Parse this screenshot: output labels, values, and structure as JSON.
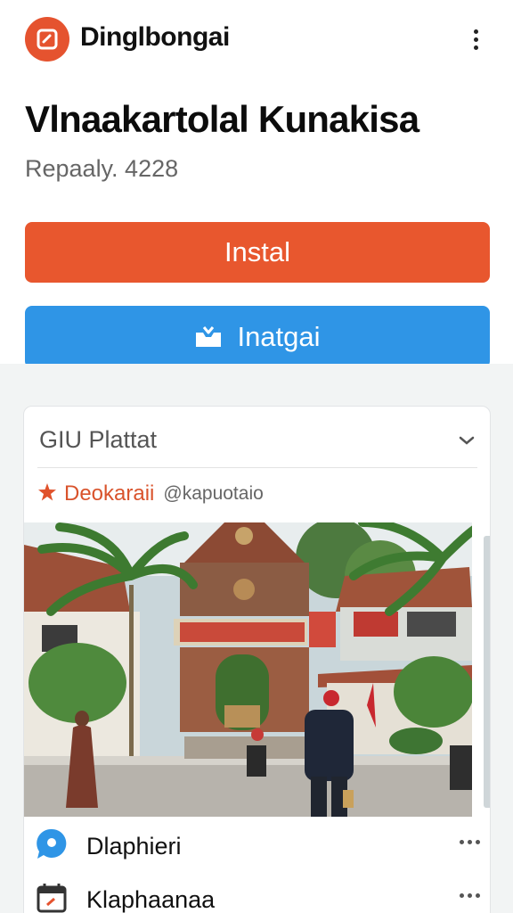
{
  "app": {
    "name": "Dinglbongai"
  },
  "title": "Vlnaakartolal Kunakisa",
  "subtitle": "Repaaly. 4228",
  "buttons": {
    "install_label": "Instal",
    "secondary_label": "Inatgai"
  },
  "card": {
    "heading": "GIU Plattat",
    "author": "Deokaraii",
    "handle": "@kapuotaio",
    "items": [
      {
        "label": "Dlaphieri",
        "icon": "chat-bubble-icon"
      },
      {
        "label": "Klaphaanaa",
        "icon": "calendar-icon"
      }
    ]
  },
  "colors": {
    "accent_orange": "#e8572e",
    "accent_blue": "#2f95e6",
    "logo_bg": "#e5532f"
  }
}
